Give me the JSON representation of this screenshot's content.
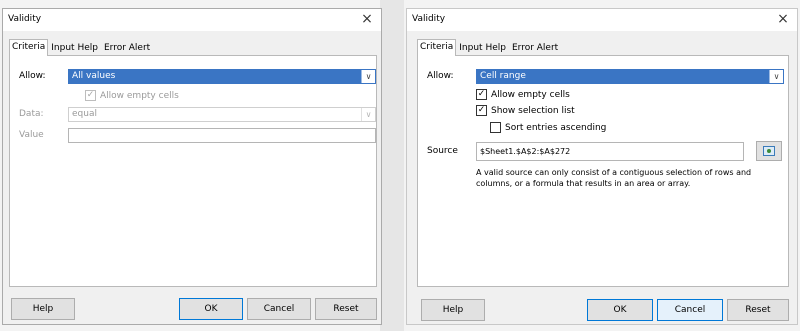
{
  "left": {
    "title": "Validity",
    "close": "×",
    "tabs": [
      "Criteria",
      "Input Help",
      "Error Alert"
    ],
    "allow_label": "Allow:",
    "allow_value": "All values",
    "allow_empty_label": "Allow empty cells",
    "data_label": "Data:",
    "data_value": "equal",
    "value_label": "Value",
    "value_value": "",
    "buttons": {
      "help": "Help",
      "ok": "OK",
      "cancel": "Cancel",
      "reset": "Reset"
    }
  },
  "right": {
    "title": "Validity",
    "close": "×",
    "tabs": [
      "Criteria",
      "Input Help",
      "Error Alert"
    ],
    "allow_label": "Allow:",
    "allow_value": "Cell range",
    "allow_empty_label": "Allow empty cells",
    "show_selection_label": "Show selection list",
    "sort_label": "Sort entries ascending",
    "source_label": "Source",
    "source_value": "$Sheet1.$A$2:$A$272",
    "help_text_1": "A valid source can only consist of a contiguous selection of rows and",
    "help_text_2": "columns, or a formula that results in an area or array.",
    "buttons": {
      "help": "Help",
      "ok": "OK",
      "cancel": "Cancel",
      "reset": "Reset"
    }
  },
  "icons": {
    "check": "✓",
    "dropdown": "∨"
  }
}
